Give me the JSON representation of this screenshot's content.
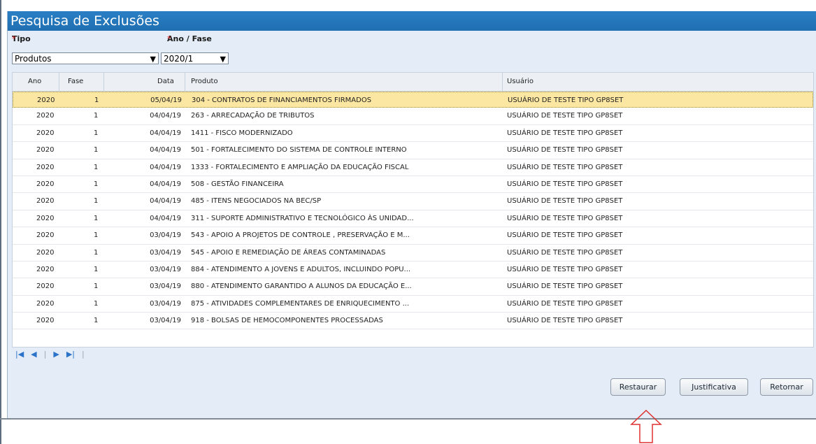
{
  "panel": {
    "title": "Pesquisa de Exclusões"
  },
  "filters": {
    "tipo_label": "Tipo",
    "tipo_value": "Produtos",
    "ano_fase_label": "Ano / Fase",
    "ano_fase_value": "2020/1",
    "required_mark": "*"
  },
  "grid": {
    "columns": [
      "Ano",
      "Fase",
      "Data",
      "Produto",
      "Usuário"
    ],
    "rows": [
      {
        "ano": "2020",
        "fase": "1",
        "data": "05/04/19",
        "produto": "304 - CONTRATOS DE FINANCIAMENTOS FIRMADOS",
        "usuario": "USUÁRIO DE TESTE TIPO GP8SET"
      },
      {
        "ano": "2020",
        "fase": "1",
        "data": "04/04/19",
        "produto": "263 - ARRECADAÇÃO DE TRIBUTOS",
        "usuario": "USUÁRIO DE TESTE TIPO GP8SET"
      },
      {
        "ano": "2020",
        "fase": "1",
        "data": "04/04/19",
        "produto": "1411 - FISCO MODERNIZADO",
        "usuario": "USUÁRIO DE TESTE TIPO GP8SET"
      },
      {
        "ano": "2020",
        "fase": "1",
        "data": "04/04/19",
        "produto": "501 - FORTALECIMENTO DO SISTEMA DE CONTROLE INTERNO",
        "usuario": "USUÁRIO DE TESTE TIPO GP8SET"
      },
      {
        "ano": "2020",
        "fase": "1",
        "data": "04/04/19",
        "produto": "1333 - FORTALECIMENTO E AMPLIAÇÃO DA EDUCAÇÃO FISCAL",
        "usuario": "USUÁRIO DE TESTE TIPO GP8SET"
      },
      {
        "ano": "2020",
        "fase": "1",
        "data": "04/04/19",
        "produto": "508 - GESTÃO FINANCEIRA",
        "usuario": "USUÁRIO DE TESTE TIPO GP8SET"
      },
      {
        "ano": "2020",
        "fase": "1",
        "data": "04/04/19",
        "produto": "485 - ITENS NEGOCIADOS NA BEC/SP",
        "usuario": "USUÁRIO DE TESTE TIPO GP8SET"
      },
      {
        "ano": "2020",
        "fase": "1",
        "data": "04/04/19",
        "produto": "311 - SUPORTE ADMINISTRATIVO E TECNOLÓGICO ÀS UNIDAD...",
        "usuario": "USUÁRIO DE TESTE TIPO GP8SET"
      },
      {
        "ano": "2020",
        "fase": "1",
        "data": "03/04/19",
        "produto": "543 - APOIO A PROJETOS DE CONTROLE , PRESERVAÇÃO E M...",
        "usuario": "USUÁRIO DE TESTE TIPO GP8SET"
      },
      {
        "ano": "2020",
        "fase": "1",
        "data": "03/04/19",
        "produto": "545 - APOIO E REMEDIAÇÃO DE ÁREAS CONTAMINADAS",
        "usuario": "USUÁRIO DE TESTE TIPO GP8SET"
      },
      {
        "ano": "2020",
        "fase": "1",
        "data": "03/04/19",
        "produto": "884 - ATENDIMENTO A JOVENS E ADULTOS, INCLUINDO POPU...",
        "usuario": "USUÁRIO DE TESTE TIPO GP8SET"
      },
      {
        "ano": "2020",
        "fase": "1",
        "data": "03/04/19",
        "produto": "880 - ATENDIMENTO GARANTIDO A ALUNOS DA EDUCAÇÃO E...",
        "usuario": "USUÁRIO DE TESTE TIPO GP8SET"
      },
      {
        "ano": "2020",
        "fase": "1",
        "data": "03/04/19",
        "produto": "875 - ATIVIDADES COMPLEMENTARES DE ENRIQUECIMENTO ...",
        "usuario": "USUÁRIO DE TESTE TIPO GP8SET"
      },
      {
        "ano": "2020",
        "fase": "1",
        "data": "03/04/19",
        "produto": "918 - BOLSAS DE HEMOCOMPONENTES PROCESSADAS",
        "usuario": "USUÁRIO DE TESTE TIPO GP8SET"
      }
    ],
    "selected_row": 0
  },
  "pager": {
    "icons": [
      "first-page-icon",
      "prev-page-icon",
      "next-page-icon",
      "last-page-icon"
    ]
  },
  "buttons": {
    "restaurar": "Restaurar",
    "justificativa": "Justificativa",
    "retornar": "Retornar"
  },
  "colors": {
    "title_bar": "#1f6fb2",
    "selected_row": "#fbe7a1",
    "panel_bg": "#e3ecf7",
    "arrow_annotation": "#e03030"
  }
}
